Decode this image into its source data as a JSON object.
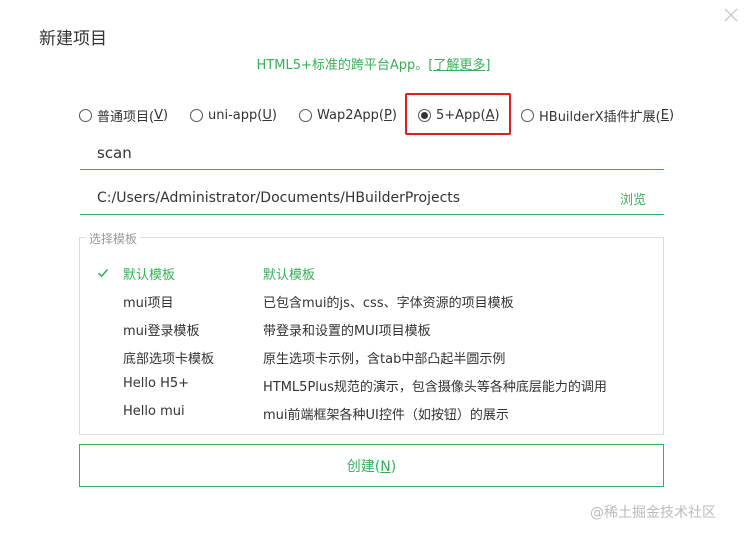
{
  "dialog": {
    "title": "新建项目",
    "subtitle_text": "HTML5+标准的跨平台App。",
    "learn_more": {
      "open": "[",
      "label": "了解更多",
      "close": "]"
    }
  },
  "project_types": [
    {
      "label": "普通项目(",
      "key": "V",
      "suffix": ")",
      "selected": false
    },
    {
      "label": "uni-app(",
      "key": "U",
      "suffix": ")",
      "selected": false
    },
    {
      "label": "Wap2App(",
      "key": "P",
      "suffix": ")",
      "selected": false
    },
    {
      "label": "5+App(",
      "key": "A",
      "suffix": ")",
      "selected": true
    },
    {
      "label": "HBuilderX插件扩展(",
      "key": "E",
      "suffix": ")",
      "selected": false
    }
  ],
  "project_name": {
    "value": "scan"
  },
  "project_path": {
    "value": "C:/Users/Administrator/Documents/HBuilderProjects",
    "browse_label": "浏览"
  },
  "templates": {
    "legend": "选择模板",
    "items": [
      {
        "name": "默认模板",
        "description": "默认模板",
        "selected": true
      },
      {
        "name": "mui项目",
        "description": "已包含mui的js、css、字体资源的项目模板",
        "selected": false
      },
      {
        "name": "mui登录模板",
        "description": "带登录和设置的MUI项目模板",
        "selected": false
      },
      {
        "name": "底部选项卡模板",
        "description": "原生选项卡示例，含tab中部凸起半圆示例",
        "selected": false
      },
      {
        "name": "Hello H5+",
        "description": "HTML5Plus规范的演示，包含摄像头等各种底层能力的调用",
        "selected": false
      },
      {
        "name": "Hello mui",
        "description": "mui前端框架各种UI控件（如按钮）的展示",
        "selected": false
      }
    ]
  },
  "create_button": {
    "label": "创建(",
    "key": "N",
    "suffix": ")"
  },
  "watermark": "@稀土掘金技术社区",
  "colors": {
    "accent": "#36b058",
    "highlight": "#e02020",
    "border": "#dcdcdc"
  },
  "icons": {
    "close": "close-icon",
    "check": "check-icon"
  }
}
